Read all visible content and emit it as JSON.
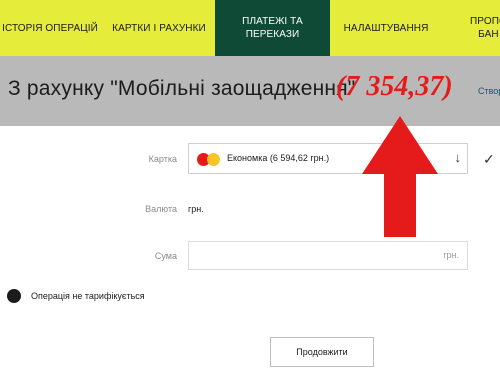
{
  "nav": {
    "items": [
      {
        "label": "ІСТОРІЯ ОПЕРАЦІЙ"
      },
      {
        "label": "КАРТКИ І РАХУНКИ"
      },
      {
        "label": "ПЛАТЕЖІ ТА ПЕРЕКАЗИ"
      },
      {
        "label": "НАЛАШТУВАННЯ"
      },
      {
        "label": "ПРОПО БАН"
      }
    ]
  },
  "banner": {
    "title": "З рахунку \"Мобільні заощадження\"",
    "amount": "(7 354,37)",
    "create_link": "Створ"
  },
  "form": {
    "card_label": "Картка",
    "card_value": "Економка  (6 594,62  грн.)",
    "card_arrow": "↓",
    "confirm_icon": "✓",
    "currency_label": "Валюта",
    "currency_value": "грн.",
    "sum_label": "Сума",
    "sum_unit": "грн.",
    "tariff_text": "Операція не тарифікується",
    "continue_label": "Продовжити"
  },
  "colors": {
    "nav_bg": "#e6ec3a",
    "nav_active_bg": "#0f4a37",
    "banner_bg": "#b9b9b9",
    "amount": "#e51b1b",
    "arrow": "#e51b1b"
  },
  "icons": {
    "card_brand": "mastercard-icon",
    "dropdown": "arrow-down-icon",
    "confirm": "checkmark-icon",
    "annotation": "red-up-arrow-icon"
  }
}
